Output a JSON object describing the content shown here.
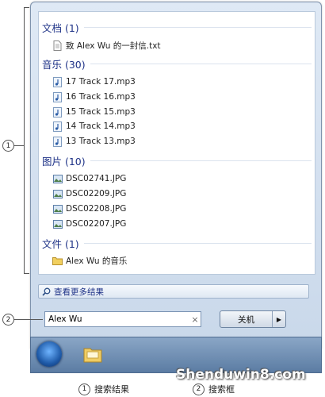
{
  "results": {
    "groups": [
      {
        "title": "文档 (1)",
        "items": [
          {
            "label": "致 Alex Wu 的一封信.txt",
            "icon": "text-file-icon"
          }
        ]
      },
      {
        "title": "音乐 (30)",
        "items": [
          {
            "label": "17 Track 17.mp3",
            "icon": "music-file-icon"
          },
          {
            "label": "16 Track 16.mp3",
            "icon": "music-file-icon"
          },
          {
            "label": "15 Track 15.mp3",
            "icon": "music-file-icon"
          },
          {
            "label": "14 Track 14.mp3",
            "icon": "music-file-icon"
          },
          {
            "label": "13 Track 13.mp3",
            "icon": "music-file-icon"
          }
        ]
      },
      {
        "title": "图片 (10)",
        "items": [
          {
            "label": "DSC02741.JPG",
            "icon": "image-file-icon"
          },
          {
            "label": "DSC02209.JPG",
            "icon": "image-file-icon"
          },
          {
            "label": "DSC02208.JPG",
            "icon": "image-file-icon"
          },
          {
            "label": "DSC02207.JPG",
            "icon": "image-file-icon"
          }
        ]
      },
      {
        "title": "文件 (1)",
        "items": [
          {
            "label": "Alex Wu 的音乐",
            "icon": "folder-icon"
          }
        ]
      }
    ]
  },
  "see_more": "查看更多结果",
  "search": {
    "value": "Alex Wu",
    "clear": "×"
  },
  "shutdown": {
    "label": "关机",
    "arrow": "▶"
  },
  "callouts": {
    "one": "1",
    "two": "2"
  },
  "legend": {
    "item1": "搜索结果",
    "item2": "搜索框"
  },
  "watermark": "Shenduwin8.com"
}
